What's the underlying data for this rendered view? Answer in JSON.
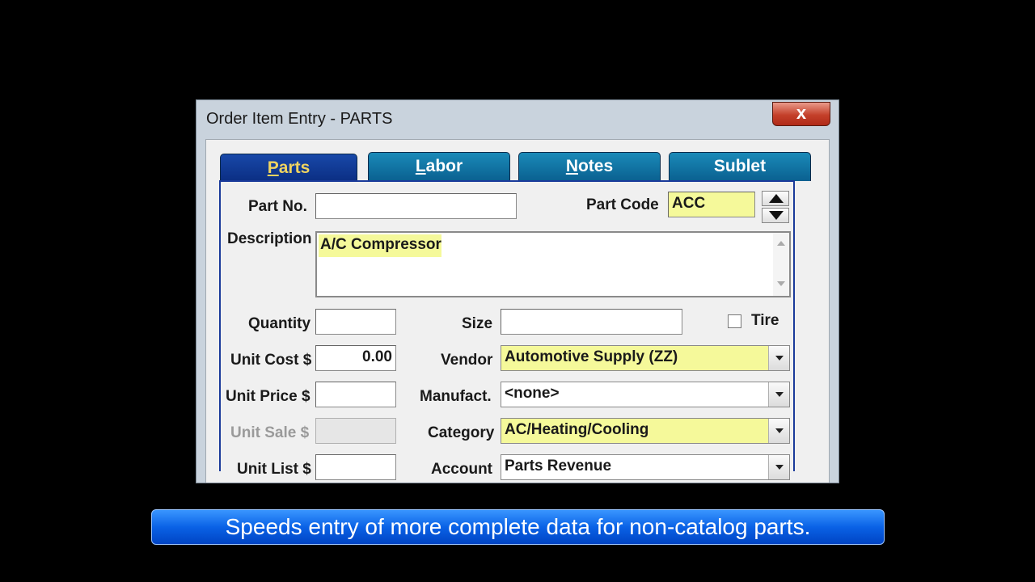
{
  "window": {
    "title": "Order Item Entry - PARTS",
    "close_label": "x"
  },
  "tabs": [
    {
      "key": "P",
      "rest": "arts"
    },
    {
      "key": "L",
      "rest": "abor"
    },
    {
      "key": "N",
      "rest": "otes"
    },
    {
      "key": "",
      "rest": "Sublet"
    }
  ],
  "form": {
    "part_no": {
      "label": "Part No.",
      "value": ""
    },
    "part_code": {
      "label": "Part Code",
      "value": "ACC"
    },
    "description": {
      "label": "Description",
      "value": "A/C Compressor"
    },
    "quantity": {
      "label": "Quantity",
      "value": ""
    },
    "size": {
      "label": "Size",
      "value": ""
    },
    "tire": {
      "label": "Tire",
      "checked": false
    },
    "unit_cost": {
      "label": "Unit Cost $",
      "value": "0.00"
    },
    "vendor": {
      "label": "Vendor",
      "value": "Automotive Supply (ZZ)"
    },
    "unit_price": {
      "label": "Unit Price $",
      "value": ""
    },
    "manufact": {
      "label": "Manufact.",
      "value": "<none>"
    },
    "unit_sale": {
      "label": "Unit Sale $",
      "value": ""
    },
    "category": {
      "label": "Category",
      "value": "AC/Heating/Cooling"
    },
    "unit_list": {
      "label": "Unit List $",
      "value": ""
    },
    "account": {
      "label": "Account",
      "value": "Parts Revenue"
    }
  },
  "caption": "Speeds entry of more complete data for non-catalog parts.",
  "colors": {
    "highlight": "#f5f99a",
    "tab_active": "#1848a8",
    "tab_inactive": "#1a8ab8",
    "caption_bg": "#0a62e6"
  }
}
